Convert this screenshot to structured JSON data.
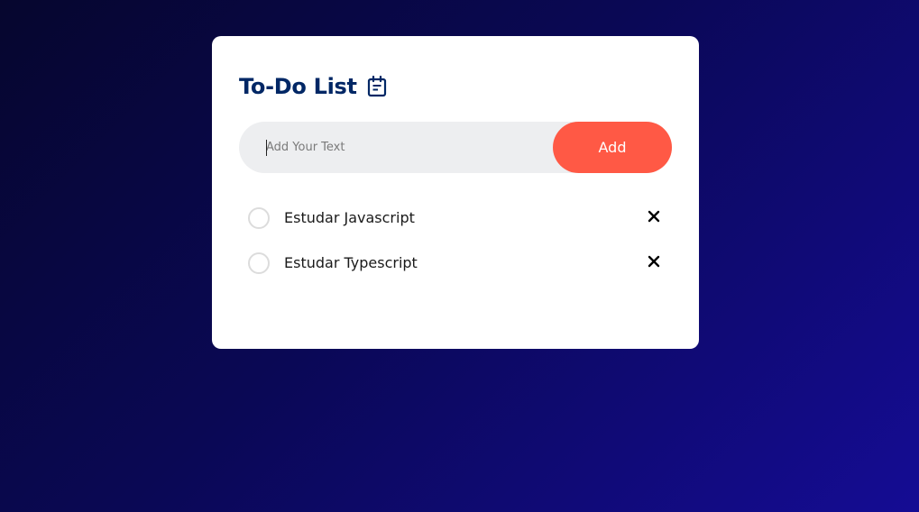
{
  "header": {
    "title": "To-Do List",
    "title_icon": "calendar-note-icon"
  },
  "input": {
    "placeholder": "Add Your Text",
    "value": "",
    "add_label": "Add"
  },
  "tasks": [
    {
      "label": "Estudar Javascript",
      "checked": false
    },
    {
      "label": "Estudar Typescript",
      "checked": false
    }
  ],
  "colors": {
    "accent": "#ff5945",
    "title": "#002765",
    "input_bg": "#edeef0",
    "card_bg": "#ffffff",
    "bg_start": "#06062e",
    "bg_end": "#150c94"
  }
}
